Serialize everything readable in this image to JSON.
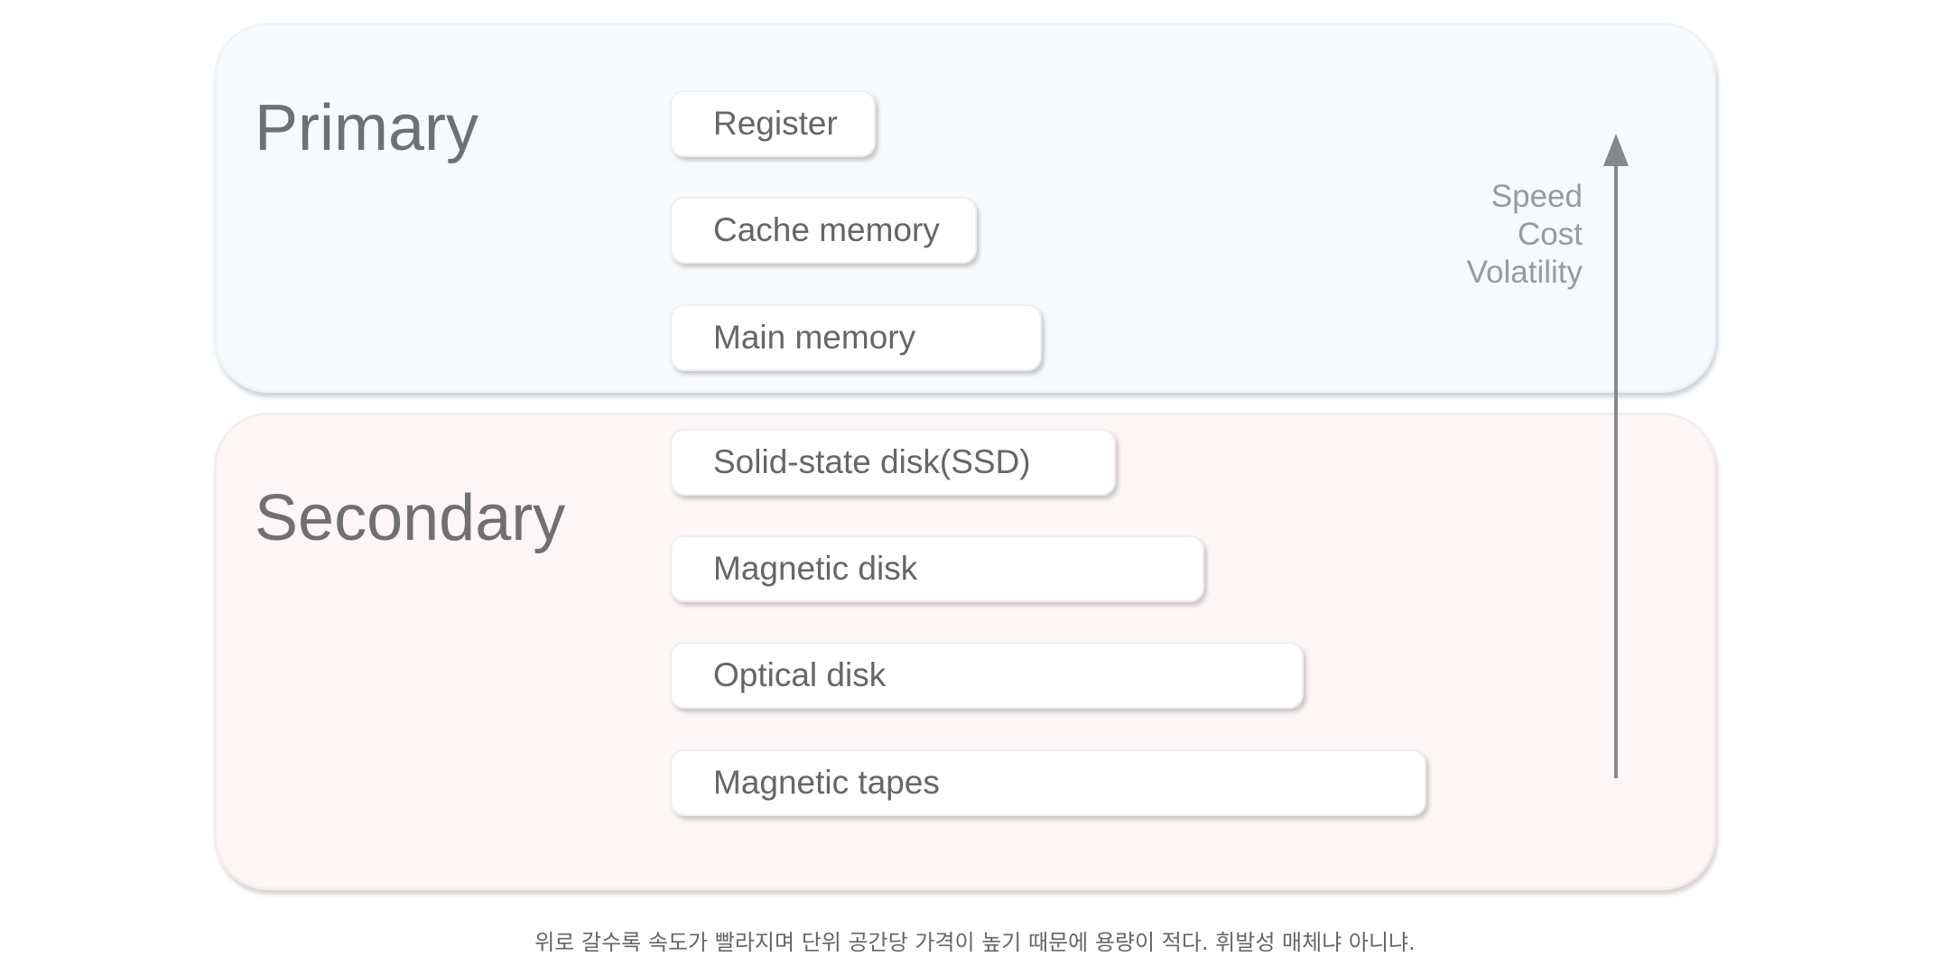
{
  "groups": {
    "primary": "Primary",
    "secondary": "Secondary"
  },
  "primary_items": [
    "Register",
    "Cache memory",
    "Main memory"
  ],
  "secondary_items": [
    "Solid-state disk(SSD)",
    "Magnetic disk",
    "Optical disk",
    "Magnetic tapes"
  ],
  "axis": {
    "direction": "up",
    "labels": [
      "Speed",
      "Cost",
      "Volatility"
    ]
  },
  "caption": "위로 갈수록 속도가 빨라지며 단위 공간당 가격이 높기 때문에 용량이 적다. 휘발성 매체냐 아니냐.",
  "colors": {
    "primary_bg": "#f6fafd",
    "secondary_bg": "#fcf6f6",
    "arrow": "#888888"
  }
}
